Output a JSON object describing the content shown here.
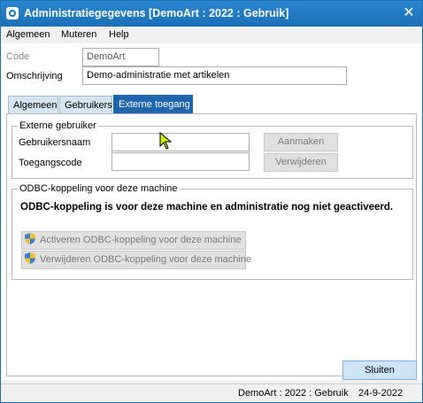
{
  "window": {
    "title": "Administratiegegevens  [DemoArt : 2022 : Gebruik]",
    "close_glyph": "✕"
  },
  "menu": {
    "items": [
      {
        "label": "Algemeen"
      },
      {
        "label": "Muteren"
      },
      {
        "label": "Help"
      }
    ]
  },
  "header": {
    "code_label": "Code",
    "code_value": "DemoArt",
    "description_label": "Omschrijving",
    "description_value": "Demo-administratie met artikelen"
  },
  "tabs": [
    {
      "label": "Algemeen",
      "active": false
    },
    {
      "label": "Gebruikers",
      "active": false
    },
    {
      "label": "Externe toegang",
      "active": true
    }
  ],
  "external_users": {
    "group_title": "Externe gebruiker",
    "username_label": "Gebruikersnaam",
    "username_value": "",
    "access_code_label": "Toegangscode",
    "access_code_value": "",
    "create_button": "Aanmaken",
    "delete_button": "Verwijderen"
  },
  "odbc": {
    "group_title": "ODBC-koppeling voor deze machine",
    "status_message": "ODBC-koppeling is voor deze machine en administratie nog niet geactiveerd.",
    "activate_button": "Activeren ODBC-koppeling voor deze machine",
    "remove_button": "Verwijderen ODBC-koppeling voor deze machine"
  },
  "footer": {
    "close_button": "Sluiten"
  },
  "statusbar": {
    "context": "DemoArt : 2022 : Gebruik",
    "date": "24-9-2022"
  },
  "colors": {
    "titlebar": "#1a6fb3",
    "active_tab": "#1e66ad",
    "inactive_tab": "#d4e6f4",
    "primary_button": "#cde5f8",
    "disabled_button": "#e0e0e0"
  }
}
